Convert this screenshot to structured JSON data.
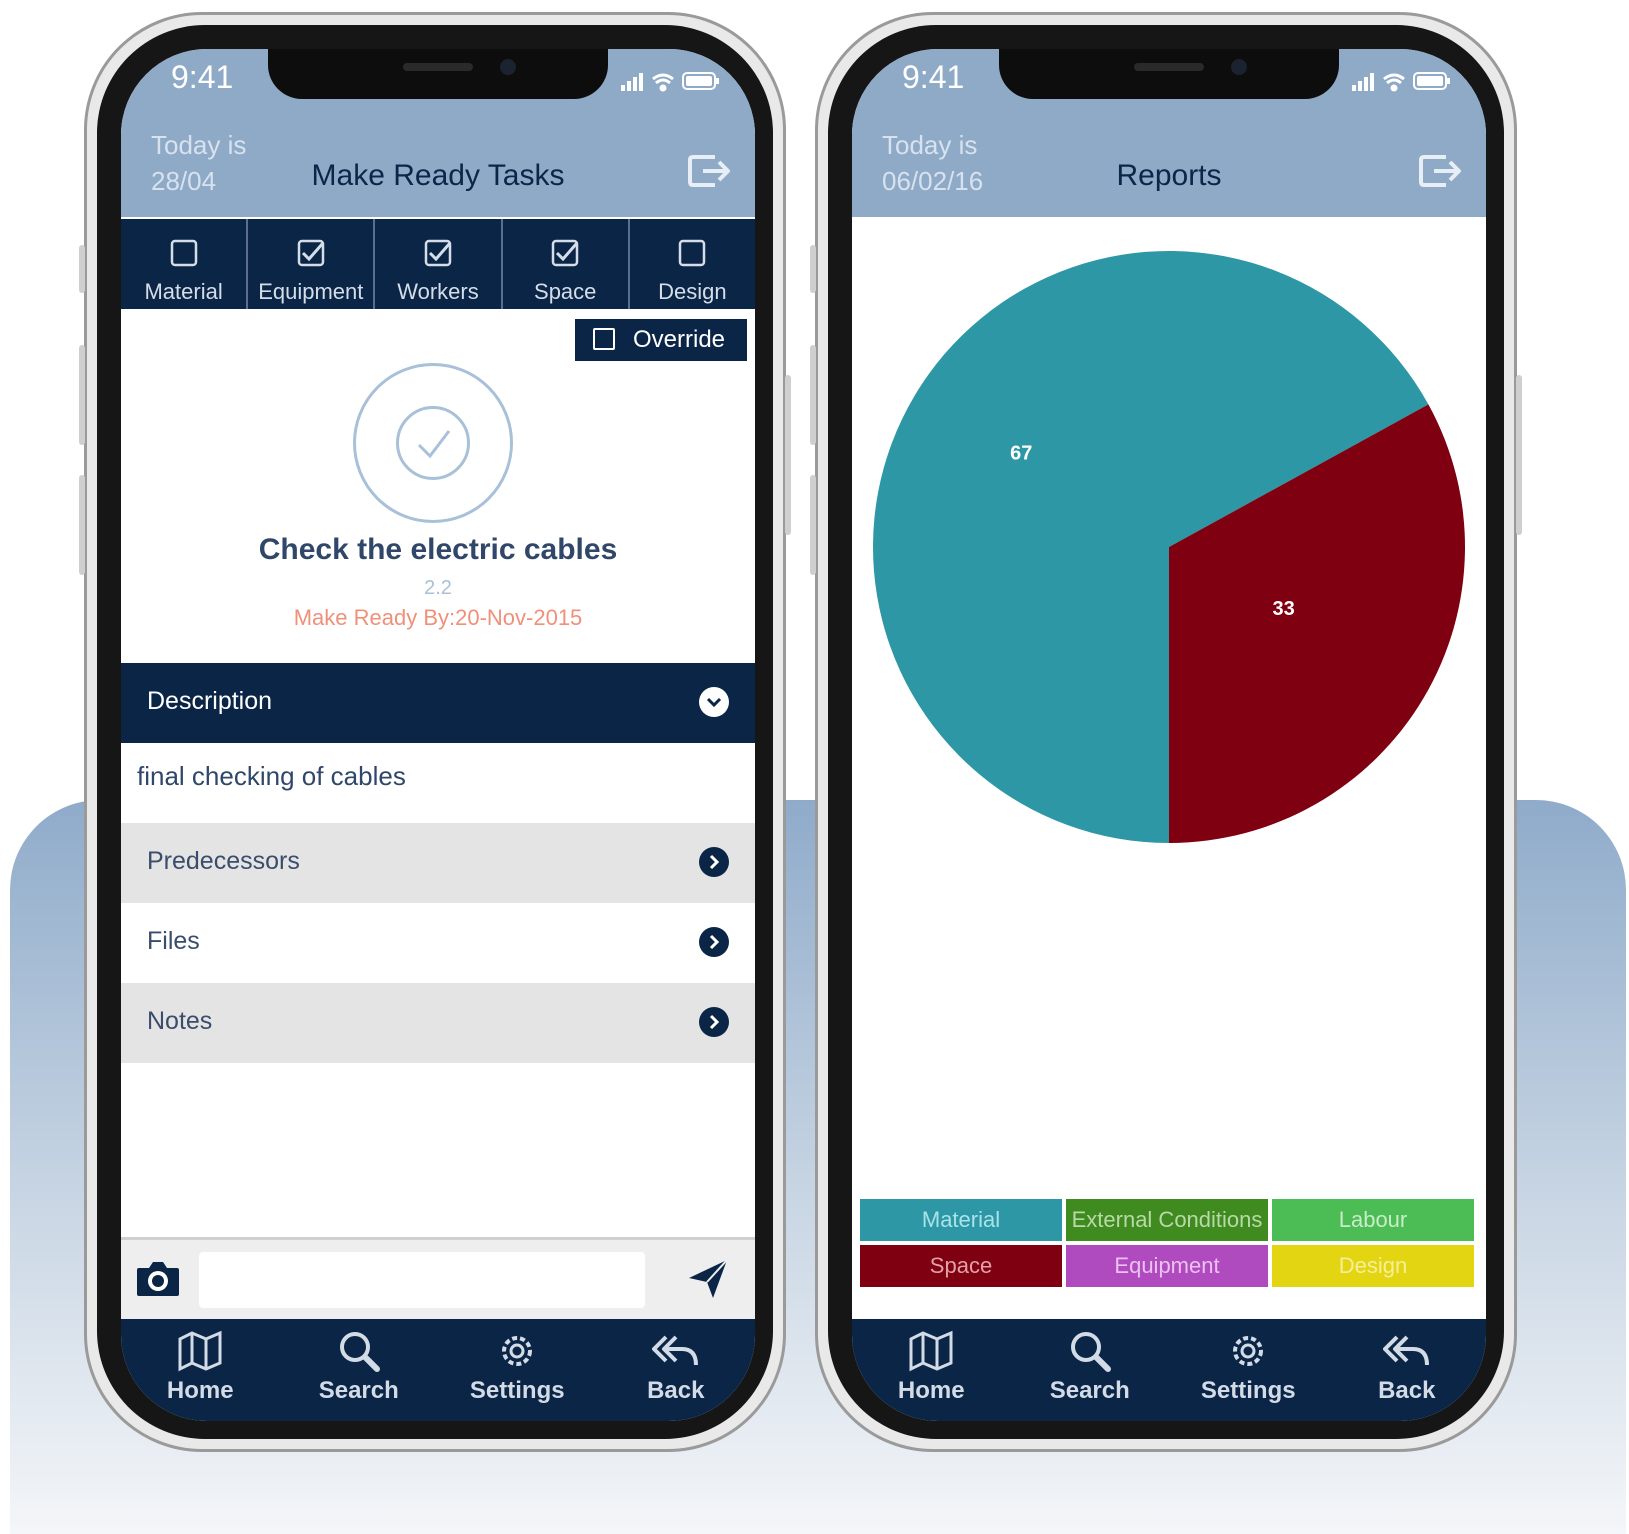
{
  "colors": {
    "navy": "#0b2547",
    "header": "#8eaac7",
    "teal": "#2e97a6",
    "maroon": "#7f0010",
    "accent_date": "#f0907a"
  },
  "phone1": {
    "status": {
      "time": "9:41"
    },
    "header": {
      "today_line1": "Today is",
      "today_line2": "28/04",
      "title": "Make Ready Tasks",
      "logout_icon": "logout-icon"
    },
    "tabs": [
      {
        "label": "Material",
        "checked": false
      },
      {
        "label": "Equipment",
        "checked": true
      },
      {
        "label": "Workers",
        "checked": true
      },
      {
        "label": "Space",
        "checked": true
      },
      {
        "label": "Design",
        "checked": false
      }
    ],
    "override_label": "Override",
    "task": {
      "title": "Check the electric cables",
      "number": "2.2",
      "make_ready": "Make Ready By:20-Nov-2015"
    },
    "description": {
      "label": "Description",
      "text": "final checking of cables"
    },
    "rows": [
      {
        "label": "Predecessors"
      },
      {
        "label": "Files"
      },
      {
        "label": "Notes"
      }
    ],
    "composer": {
      "placeholder": "",
      "value": ""
    },
    "nav": [
      {
        "label": "Home"
      },
      {
        "label": "Search"
      },
      {
        "label": "Settings"
      },
      {
        "label": "Back"
      }
    ]
  },
  "phone2": {
    "status": {
      "time": "9:41"
    },
    "header": {
      "today_line1": "Today is",
      "today_line2": "06/02/16",
      "title": "Reports",
      "logout_icon": "logout-icon"
    },
    "legend": [
      {
        "label": "Material",
        "color": "#2e97a6",
        "text_color": "#a9e3ea"
      },
      {
        "label": "External Conditions",
        "color": "#3f8b1f",
        "text_color": "#b8d9a8"
      },
      {
        "label": "Labour",
        "color": "#4cbd55",
        "text_color": "#c9ecc9"
      },
      {
        "label": "Space",
        "color": "#7f0010",
        "text_color": "#e3a0a6"
      },
      {
        "label": "Equipment",
        "color": "#b04bbf",
        "text_color": "#ebc1f0"
      },
      {
        "label": "Design",
        "color": "#e4d512",
        "text_color": "#f6ee9a"
      }
    ],
    "nav": [
      {
        "label": "Home"
      },
      {
        "label": "Search"
      },
      {
        "label": "Settings"
      },
      {
        "label": "Back"
      }
    ]
  },
  "chart_data": {
    "type": "pie",
    "categories": [
      "Material",
      "Space"
    ],
    "values": [
      67,
      33
    ],
    "colors": [
      "#2e97a6",
      "#7f0010"
    ],
    "data_labels": [
      "67",
      "33"
    ],
    "title": ""
  }
}
